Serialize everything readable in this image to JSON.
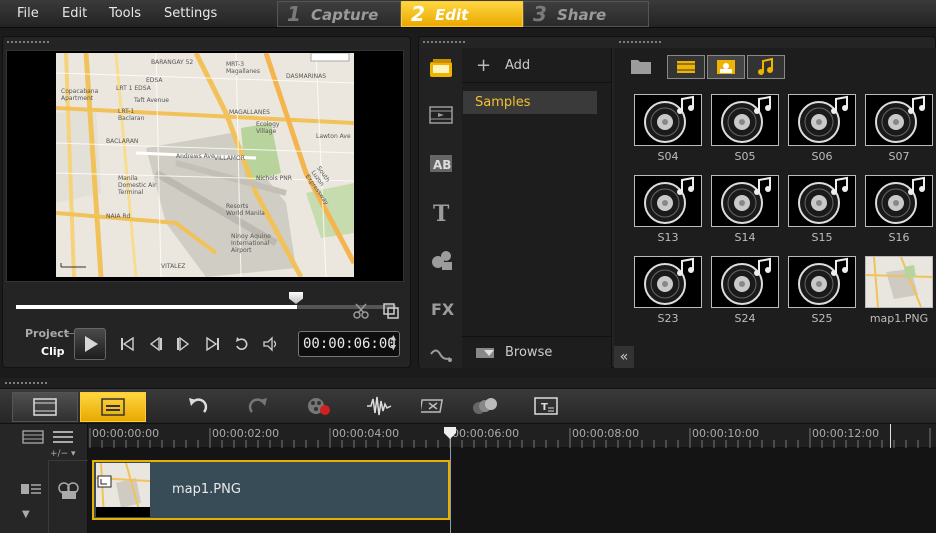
{
  "menu": {
    "items": [
      "File",
      "Edit",
      "Tools",
      "Settings"
    ]
  },
  "steps": [
    {
      "num": "1",
      "label": "Capture",
      "active": false
    },
    {
      "num": "2",
      "label": "Edit",
      "active": true
    },
    {
      "num": "3",
      "label": "Share",
      "active": false
    }
  ],
  "preview": {
    "mode_project": "Project",
    "mode_clip": "Clip",
    "timecode": "00:00:06:00",
    "scrub_progress": 0.74
  },
  "library": {
    "add_label": "Add",
    "folders": [
      "Samples"
    ],
    "browse_label": "Browse",
    "thumbnails": [
      "S04",
      "S05",
      "S06",
      "S07",
      "S13",
      "S14",
      "S15",
      "S16",
      "S23",
      "S24",
      "S25",
      "map1.PNG"
    ]
  },
  "timeline": {
    "zoom_label": "+/−",
    "ruler": [
      "00:00:00:00",
      "00:00:02:00",
      "00:00:04:00",
      "00:00:06:00",
      "00:00:08:00",
      "00:00:10:00",
      "00:00:12:00"
    ],
    "clip": {
      "name": "map1.PNG"
    }
  },
  "colors": {
    "accent": "#f0b400",
    "clip_bg": "#384c58"
  },
  "map": {
    "labels": [
      "BARANGAY 52",
      "EDSA",
      "MRT-3 Magallanes",
      "DASMARINAS",
      "Copacabana Apartment",
      "LRT 1 EDSA",
      "LRT-1 Baclaran",
      "Taft Avenue",
      "MAGALLANES",
      "Ecology Village",
      "BACLARAN",
      "Andrews Ave",
      "VILLAMOR",
      "Manila Domestic Air Terminal",
      "Nichols PNR",
      "Resorts World Manila",
      "South Luzon Expressway",
      "NAIA Rd",
      "Ninoy Aquino International Airport",
      "VITALEZ",
      "Lawton Ave"
    ]
  }
}
